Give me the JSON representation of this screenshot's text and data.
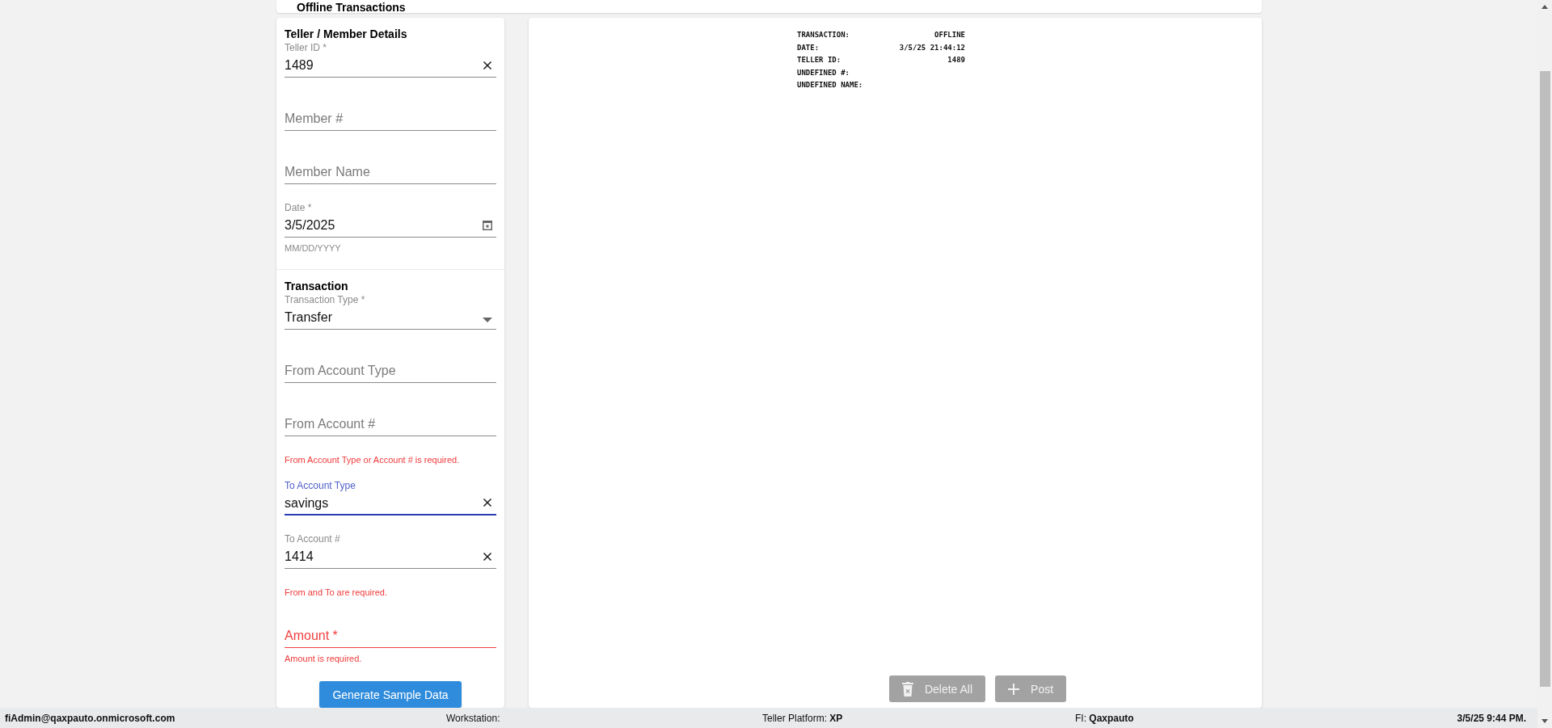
{
  "header": {
    "title": "Offline Transactions"
  },
  "sections": [
    {
      "title": "Teller / Member Details",
      "items": [
        {
          "kind": "text",
          "label": "Teller ID *",
          "value": "1489"
        },
        {
          "kind": "text",
          "placeholder": "Member #"
        },
        {
          "kind": "text",
          "placeholder": "Member Name"
        },
        {
          "kind": "date",
          "label": "Date *",
          "value": "3/5/2025",
          "helper": "MM/DD/YYYY"
        }
      ]
    },
    {
      "title": "Transaction",
      "items": [
        {
          "kind": "select",
          "label": "Transaction Type *",
          "value": "Transfer"
        },
        {
          "kind": "text",
          "placeholder": "From Account Type"
        },
        {
          "kind": "text",
          "placeholder": "From Account #"
        },
        {
          "kind": "message",
          "text": "From Account Type or Account # is required."
        },
        {
          "kind": "text",
          "label": "To Account Type",
          "value": "savings",
          "focused": true
        },
        {
          "kind": "text",
          "label": "To Account #",
          "value": "1414"
        },
        {
          "kind": "message",
          "text": "From and To are required."
        },
        {
          "kind": "text",
          "placeholder": "Amount *",
          "invalid": true,
          "error": "Amount is required."
        }
      ],
      "button": "Generate Sample Data"
    }
  ],
  "receipt": [
    {
      "label": "TRANSACTION:",
      "value": "OFFLINE"
    },
    {
      "label": "DATE:",
      "value": "3/5/25 21:44:12"
    },
    {
      "label": "TELLER ID:",
      "value": "1489"
    },
    {
      "label": "UNDEFINED #:"
    },
    {
      "label": "UNDEFINED NAME:"
    }
  ],
  "actions": [
    {
      "kind": "delete",
      "label": "Delete All",
      "disabled": true
    },
    {
      "kind": "add",
      "label": "Post",
      "disabled": true
    }
  ],
  "status_bar": {
    "user": "fiAdmin@qaxpauto.onmicrosoft.com",
    "workstation": "Workstation:",
    "platform": "Teller Platform: **XP**",
    "fi": "FI: **Qaxpauto**",
    "datetime": "3/5/25 9:44 PM."
  }
}
